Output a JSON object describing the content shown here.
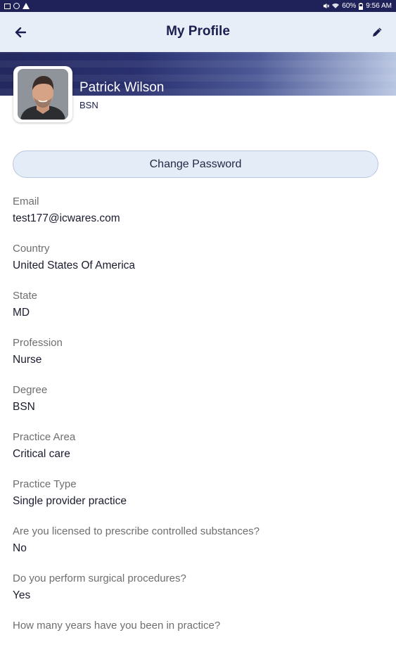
{
  "status_bar": {
    "battery": "60%",
    "time": "9:56 AM"
  },
  "header": {
    "title": "My Profile",
    "back_icon": "arrow-left-icon",
    "edit_icon": "pencil-icon"
  },
  "profile": {
    "name": "Patrick Wilson",
    "degree": "BSN"
  },
  "actions": {
    "change_password": "Change Password"
  },
  "fields": [
    {
      "label": "Email",
      "value": "test177@icwares.com"
    },
    {
      "label": "Country",
      "value": "United States Of America"
    },
    {
      "label": "State",
      "value": "MD"
    },
    {
      "label": "Profession",
      "value": "Nurse"
    },
    {
      "label": "Degree",
      "value": "BSN"
    },
    {
      "label": "Practice Area",
      "value": "Critical care"
    },
    {
      "label": "Practice Type",
      "value": "Single provider practice"
    },
    {
      "label": "Are you licensed to prescribe controlled substances?",
      "value": "No"
    },
    {
      "label": "Do you perform surgical procedures?",
      "value": "Yes"
    },
    {
      "label": "How many years have you been in practice?",
      "value": ""
    }
  ],
  "colors": {
    "status_bar": "#1e2258",
    "app_bar": "#e8eef8",
    "title": "#1b1f4f",
    "banner_dark": "#23285e",
    "banner_light": "#b9c6e2",
    "button_bg": "#e4ecf8"
  }
}
